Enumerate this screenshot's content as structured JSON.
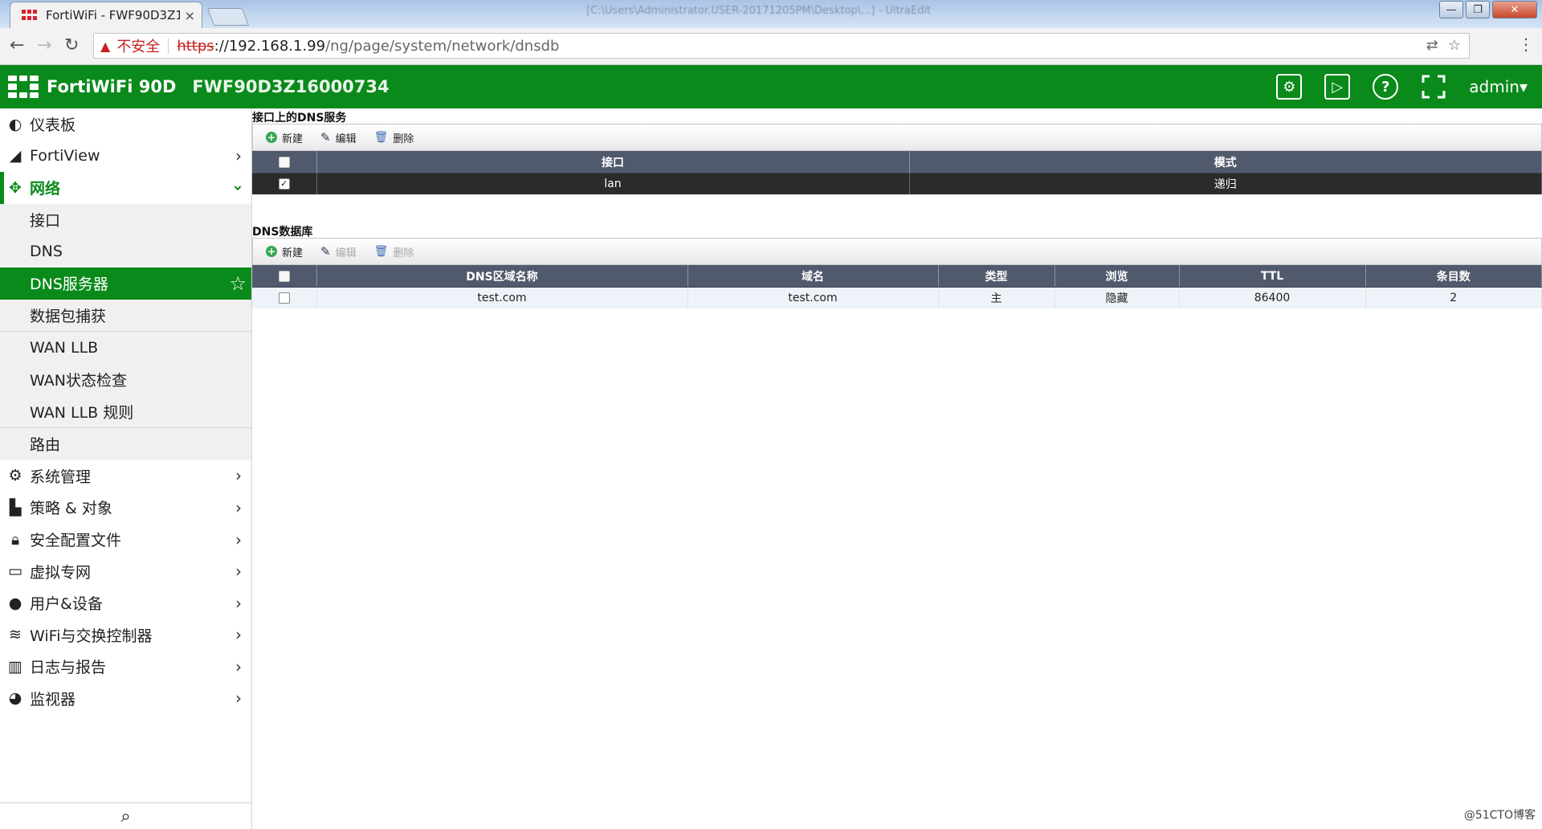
{
  "browser": {
    "tab_title": "FortiWiFi - FWF90D3Z1",
    "tab_close": "×",
    "window_title": "[C:\\Users\\Administrator.USER-20171205PM\\Desktop\\...] - UltraEdit",
    "win_min": "—",
    "win_max": "❐",
    "win_close": "✕",
    "back": "←",
    "forward": "→",
    "reload": "↻",
    "warn_icon": "▲",
    "insecure_label": "不安全",
    "url_protocol": "https",
    "url_host": "://192.168.1.99",
    "url_path": "/ng/page/system/network/dnsdb",
    "translate_icon": "⇄",
    "bookmark_icon": "☆",
    "menu_icon": "⋮"
  },
  "header": {
    "product": "FortiWiFi 90D",
    "serial": "FWF90D3Z16000734",
    "icons": [
      "settings-gear-icon",
      "video-play-icon",
      "help-icon",
      "fullscreen-icon"
    ],
    "help_glyph": "?",
    "user": "admin▾",
    "brand_color": "#0a8a1a"
  },
  "sidebar": {
    "top_items": [
      {
        "label": "仪表板",
        "icon": "dashboard-icon",
        "glyph": "◐"
      },
      {
        "label": "FortiView",
        "icon": "chart-area-icon",
        "glyph": "◢",
        "chev": "›"
      }
    ],
    "network": {
      "label": "网络",
      "icon": "move-arrows-icon",
      "glyph": "✥",
      "chev": "›"
    },
    "sub_items": [
      "接口",
      "DNS",
      "DNS服务器",
      "数据包捕获",
      "WAN LLB",
      "WAN状态检查",
      "WAN LLB 规则",
      "路由"
    ],
    "active_star": "☆",
    "bottom_items": [
      {
        "label": "系统管理",
        "icon": "gear-icon",
        "glyph": "⚙",
        "chev": "›"
      },
      {
        "label": "策略 & 对象",
        "icon": "policy-icon",
        "glyph": "▙",
        "chev": "›"
      },
      {
        "label": "安全配置文件",
        "icon": "lock-icon",
        "glyph": "🔒︎",
        "chev": "›"
      },
      {
        "label": "虚拟专网",
        "icon": "laptop-icon",
        "glyph": "▭",
        "chev": "›"
      },
      {
        "label": "用户&设备",
        "icon": "user-icon",
        "glyph": "●",
        "chev": "›"
      },
      {
        "label": "WiFi与交换控制器",
        "icon": "wifi-icon",
        "glyph": "≋",
        "chev": "›"
      },
      {
        "label": "日志与报告",
        "icon": "bar-chart-icon",
        "glyph": "▥",
        "chev": "›"
      },
      {
        "label": "监视器",
        "icon": "pie-chart-icon",
        "glyph": "◕",
        "chev": "›"
      }
    ],
    "search_glyph": "⌕"
  },
  "dns_service": {
    "title": "接口上的DNS服务",
    "toolbar": {
      "new": "新建",
      "edit": "编辑",
      "delete": "删除",
      "new_glyph": "+",
      "edit_glyph": "✎",
      "delete_glyph": "🗑︎"
    },
    "columns": [
      "接口",
      "模式"
    ],
    "rows": [
      {
        "interface": "lan",
        "mode": "递归",
        "checked": "✓"
      }
    ]
  },
  "dns_db": {
    "title": "DNS数据库",
    "toolbar": {
      "new": "新建",
      "edit": "编辑",
      "delete": "删除",
      "new_glyph": "+",
      "edit_glyph": "✎",
      "delete_glyph": "🗑︎"
    },
    "columns": [
      "DNS区域名称",
      "域名",
      "类型",
      "浏览",
      "TTL",
      "条目数"
    ],
    "rows": [
      {
        "zone": "test.com",
        "domain": "test.com",
        "type": "主",
        "view": "隐藏",
        "ttl": "86400",
        "entries": "2"
      }
    ]
  },
  "watermark": "@51CTO博客"
}
